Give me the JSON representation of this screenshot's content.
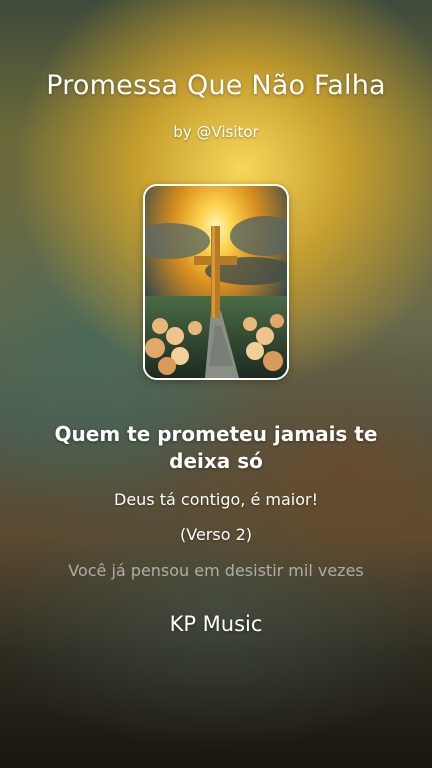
{
  "song": {
    "title": "Promessa Que Não Falha",
    "author": "by @Visitor",
    "artist": "KP Music"
  },
  "cover": {
    "icon": "cross-sunset-cover-art"
  },
  "lyrics": {
    "current": "Quem te prometeu jamais te deixa só",
    "next": "Deus tá contigo, é maior!",
    "verse_marker": "(Verso 2)",
    "upcoming": "Você já pensou em desistir mil vezes"
  },
  "colors": {
    "text": "#ffffff",
    "faded_text": "rgba(255,255,255,0.55)",
    "glow": "#f2c94c"
  }
}
